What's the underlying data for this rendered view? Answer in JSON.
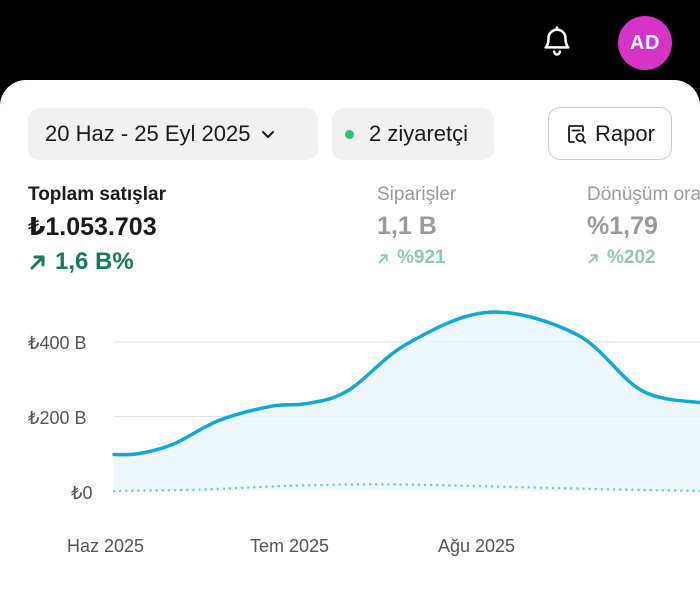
{
  "header": {
    "avatar_initials": "AD",
    "notification_icon": "bell-icon"
  },
  "filters": {
    "date_range": "20 Haz - 25 Eyl 2025",
    "visitors": "2 ziyaretçi",
    "visitors_dot_color": "#22c87a",
    "report_label": "Rapor"
  },
  "metrics": [
    {
      "label": "Toplam satışlar",
      "value": "₺1.053.703",
      "change": "1,6 B%",
      "change_icon": "arrow-up-right-icon",
      "active": true
    },
    {
      "label": "Siparişler",
      "value": "1,1 B",
      "change": "%921",
      "change_icon": "arrow-up-right-icon",
      "active": false
    },
    {
      "label": "Dönüşüm ora",
      "value": "%1,79",
      "change": "%202",
      "change_icon": "arrow-up-right-icon",
      "active": false
    }
  ],
  "chart_data": {
    "type": "area",
    "y_ticks": [
      "₺400 B",
      "₺200 B",
      "₺0"
    ],
    "x_ticks": [
      "Haz 2025",
      "Tem 2025",
      "Ağu 2025"
    ],
    "ylim": [
      0,
      400000
    ],
    "series": [
      {
        "style": "solid",
        "color": "#12a7d9",
        "x": [
          0,
          0.04,
          0.1,
          0.18,
          0.27,
          0.33,
          0.4,
          0.5,
          0.64,
          0.79,
          0.9,
          1
        ],
        "values": [
          98000,
          100000,
          125000,
          190000,
          228000,
          235000,
          270000,
          395000,
          480000,
          420000,
          270000,
          237000
        ]
      },
      {
        "style": "dotted",
        "color": "#7bc8c0",
        "x": [
          0,
          0.15,
          0.3,
          0.45,
          0.6,
          0.75,
          0.9,
          1
        ],
        "values": [
          0,
          4000,
          14000,
          18000,
          14000,
          8000,
          3000,
          0
        ]
      }
    ],
    "colors": {
      "line": "#12a7d9",
      "fill": "#e8f4f9",
      "grid": "#e3e3e3"
    },
    "grid": true
  }
}
